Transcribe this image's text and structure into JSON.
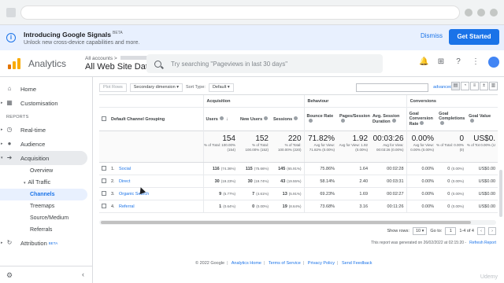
{
  "banner": {
    "title": "Introducing Google Signals",
    "badge": "BETA",
    "subtitle": "Unlock new cross-device capabilities and more.",
    "dismiss": "Dismiss",
    "cta": "Get Started"
  },
  "topbar": {
    "app_name": "Analytics",
    "breadcrumb": "All accounts >",
    "view_name": "All Web Site Data",
    "search_placeholder": "Try searching \"Pageviews in last 30 days\"",
    "notification_count": "1"
  },
  "sidebar": {
    "home": "Home",
    "customisation": "Customisation",
    "reports_label": "REPORTS",
    "realtime": "Real-time",
    "audience": "Audience",
    "acquisition": "Acquisition",
    "overview": "Overview",
    "all_traffic": "All Traffic",
    "channels": "Channels",
    "treemaps": "Treemaps",
    "source_medium": "Source/Medium",
    "referrals": "Referrals",
    "attribution": "Attribution",
    "attribution_badge": "BETA"
  },
  "toolbar": {
    "plot_rows": "Plot Rows",
    "secondary_dimension": "Secondary dimension",
    "sort_type_label": "Sort Type:",
    "sort_type_value": "Default",
    "advanced": "advanced"
  },
  "table": {
    "group_acquisition": "Acquisition",
    "group_behaviour": "Behaviour",
    "group_conversions": "Conversions",
    "col_dimension": "Default Channel Grouping",
    "col_users": "Users",
    "col_new_users": "New Users",
    "col_sessions": "Sessions",
    "col_bounce": "Bounce Rate",
    "col_pages": "Pages/Session",
    "col_duration": "Avg. Session Duration",
    "col_conv_rate": "Goal Conversion Rate",
    "col_completions": "Goal Completions",
    "col_value": "Goal Value",
    "summary": {
      "users": "154",
      "users_sub": "% of Total: 100.00% (154)",
      "new_users": "152",
      "new_users_sub": "% of Total: 100.00% (152)",
      "sessions": "220",
      "sessions_sub": "% of Total: 100.00% (220)",
      "bounce": "71.82%",
      "bounce_sub": "Avg for View: 71.82% (0.00%)",
      "pages": "1.92",
      "pages_sub": "Avg for View: 1.92 (0.00%)",
      "duration": "00:03:26",
      "duration_sub": "Avg for View: 00:03:26 (0.00%)",
      "conv_rate": "0.00%",
      "conv_rate_sub": "Avg for View: 0.00% (0.00%)",
      "completions": "0",
      "completions_sub": "% of Total: 0.00% (0)",
      "value": "US$0.",
      "value_sub": "% of Tot 0.00% (U"
    },
    "rows": [
      {
        "idx": "1.",
        "channel": "Social",
        "users": "116",
        "users_pct": "(74.36%)",
        "new_users": "115",
        "new_users_pct": "(75.66%)",
        "sessions": "145",
        "sessions_pct": "(65.91%)",
        "bounce": "75.86%",
        "pages": "1.64",
        "duration": "00:02:28",
        "conv_rate": "0.00%",
        "completions": "0",
        "completions_pct": "(0.00%)",
        "value": "US$0.00"
      },
      {
        "idx": "2.",
        "channel": "Direct",
        "users": "30",
        "users_pct": "(19.23%)",
        "new_users": "30",
        "new_users_pct": "(19.74%)",
        "sessions": "43",
        "sessions_pct": "(19.55%)",
        "bounce": "58.14%",
        "pages": "2.40",
        "duration": "00:03:31",
        "conv_rate": "0.00%",
        "completions": "0",
        "completions_pct": "(0.00%)",
        "value": "US$0.00"
      },
      {
        "idx": "3.",
        "channel": "Organic Search",
        "users": "9",
        "users_pct": "(5.77%)",
        "new_users": "7",
        "new_users_pct": "(4.61%)",
        "sessions": "13",
        "sessions_pct": "(5.91%)",
        "bounce": "69.23%",
        "pages": "1.69",
        "duration": "00:02:27",
        "conv_rate": "0.00%",
        "completions": "0",
        "completions_pct": "(0.00%)",
        "value": "US$0.00"
      },
      {
        "idx": "4.",
        "channel": "Referral",
        "users": "1",
        "users_pct": "(0.64%)",
        "new_users": "0",
        "new_users_pct": "(0.00%)",
        "sessions": "19",
        "sessions_pct": "(8.64%)",
        "bounce": "73.68%",
        "pages": "3.16",
        "duration": "00:11:26",
        "conv_rate": "0.00%",
        "completions": "0",
        "completions_pct": "(0.00%)",
        "value": "US$0.00"
      }
    ]
  },
  "pager": {
    "show_rows_label": "Show rows:",
    "show_rows_value": "10",
    "goto_label": "Go to:",
    "goto_value": "1",
    "range": "1-4 of 4"
  },
  "report_note": "This report was generated on 26/02/2022 at 02:15:20 -",
  "refresh_link": "Refresh Report",
  "footer": {
    "copyright": "© 2022 Google",
    "link1": "Analytics Home",
    "link2": "Terms of Service",
    "link3": "Privacy Policy",
    "link4": "Send Feedback"
  },
  "watermark": "Udemy"
}
